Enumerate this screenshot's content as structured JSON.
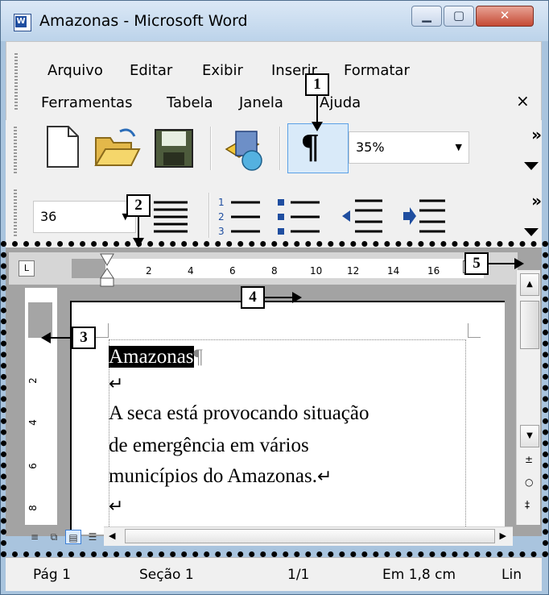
{
  "window": {
    "title": "Amazonas - Microsoft Word"
  },
  "menu": {
    "row1": [
      "Arquivo",
      "Editar",
      "Exibir",
      "Inserir",
      "Formatar"
    ],
    "row2": [
      "Ferramentas",
      "Tabela",
      "Janela",
      "Ajuda"
    ],
    "close_glyph": "×"
  },
  "toolbar": {
    "zoom_value": "35%",
    "more_glyph": "»",
    "font_size_value": "36"
  },
  "ruler": {
    "ticks": [
      "2",
      "4",
      "6",
      "8",
      "10",
      "12",
      "14",
      "16"
    ],
    "vticks": [
      "2",
      "4",
      "6",
      "8"
    ],
    "corner_glyph": "L"
  },
  "document": {
    "title": "Amazonas",
    "pilcrow": "¶",
    "line1": "A seca está provocando situação",
    "line2": "de emergência em vários",
    "line3": "municípios do Amazonas.",
    "return_glyph": "↵"
  },
  "statusbar": {
    "page": "Pág 1",
    "section": "Seção 1",
    "pages": "1/1",
    "position": "Em 1,8 cm",
    "line": "Lin"
  },
  "callouts": [
    "1",
    "2",
    "3",
    "4",
    "5"
  ]
}
